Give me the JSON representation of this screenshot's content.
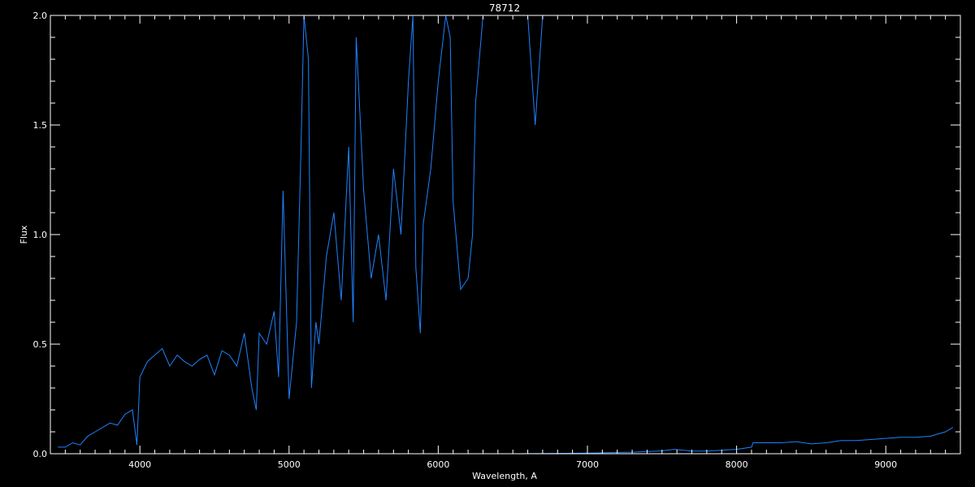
{
  "chart_data": {
    "type": "line",
    "title": "78712",
    "xlabel": "Wavelength, A",
    "ylabel": "Flux",
    "xlim": [
      3400,
      9500
    ],
    "ylim": [
      0,
      2.0
    ],
    "x_ticks": [
      4000,
      5000,
      6000,
      7000,
      8000,
      9000
    ],
    "x_tick_labels": [
      "4000",
      "5000",
      "6000",
      "7000",
      "8000",
      "9000"
    ],
    "y_ticks": [
      0.0,
      0.5,
      1.0,
      1.5,
      2.0
    ],
    "y_tick_labels": [
      "0.0",
      "0.5",
      "1.0",
      "1.5",
      "2.0"
    ],
    "grid": false,
    "background": "#000000",
    "axis_color": "#ffffff",
    "series_color": "#1e82ff",
    "series": [
      {
        "x": [
          3450,
          3500,
          3550,
          3600,
          3650,
          3700,
          3750,
          3800,
          3850,
          3900,
          3950,
          3980,
          4000,
          4050,
          4100,
          4150,
          4200,
          4250,
          4300,
          4350,
          4400,
          4450,
          4500,
          4550,
          4600,
          4650,
          4700,
          4750,
          4780,
          4800,
          4850,
          4900,
          4930,
          4960,
          5000,
          5050,
          5080,
          5100,
          5130,
          5150,
          5180,
          5200,
          5250,
          5300,
          5350,
          5400,
          5430,
          5450,
          5500,
          5550,
          5600,
          5650,
          5700,
          5750,
          5800,
          5830,
          5850,
          5880,
          5900,
          5950,
          6000,
          6050,
          6080,
          6100,
          6150,
          6200,
          6230,
          6250,
          6300,
          6350,
          6400,
          6500,
          6600,
          6650,
          6700,
          6800,
          6900,
          7000,
          7100,
          7200,
          7300,
          7400,
          7500,
          7580,
          7600,
          7700,
          7800,
          7900,
          8000,
          8100,
          8150,
          8200,
          8300,
          8400,
          8500,
          8600,
          8700,
          8800,
          8900,
          9000,
          9100,
          9200,
          9300,
          9400,
          9450
        ],
        "y": [
          0.03,
          0.03,
          0.05,
          0.04,
          0.08,
          0.1,
          0.12,
          0.14,
          0.13,
          0.18,
          0.2,
          0.04,
          0.35,
          0.42,
          0.45,
          0.48,
          0.4,
          0.45,
          0.42,
          0.4,
          0.43,
          0.45,
          0.36,
          0.47,
          0.45,
          0.4,
          0.55,
          0.3,
          0.2,
          0.55,
          0.5,
          0.65,
          0.35,
          1.2,
          0.25,
          0.6,
          1.4,
          2.0,
          1.8,
          0.3,
          0.6,
          0.5,
          0.9,
          1.1,
          0.7,
          1.4,
          0.6,
          1.9,
          1.2,
          0.8,
          1.0,
          0.7,
          1.3,
          1.0,
          1.7,
          2.0,
          0.85,
          0.55,
          1.05,
          1.3,
          1.7,
          2.0,
          1.9,
          1.15,
          0.75,
          0.8,
          1.0,
          1.6,
          2.0,
          2.0,
          2.0,
          2.0,
          2.0,
          1.5,
          2.0,
          2.0,
          2.0,
          2.0,
          2.0,
          2.0,
          2.0,
          2.0,
          2.0,
          2.0,
          2.0,
          2.0,
          2.0,
          2.0,
          2.0,
          2.0,
          2.0,
          2.0,
          2.0,
          2.0,
          2.0,
          2.0,
          2.0,
          2.0,
          2.0,
          2.0,
          2.0,
          2.0,
          2.0,
          2.0,
          2.0
        ]
      },
      {
        "x": [
          4000,
          4500,
          5000,
          5500,
          6000,
          6500,
          7000,
          7300,
          7500,
          7580,
          7700,
          7800,
          7900,
          8000,
          8100,
          8110,
          8200,
          8300,
          8400,
          8500,
          8600,
          8700,
          8800,
          8900,
          9000,
          9100,
          9200,
          9300,
          9400,
          9450
        ],
        "y": [
          0.0,
          0.0,
          0.0,
          0.0,
          0.0,
          0.0,
          0.003,
          0.007,
          0.013,
          0.02,
          0.012,
          0.012,
          0.016,
          0.02,
          0.03,
          0.05,
          0.05,
          0.05,
          0.055,
          0.045,
          0.05,
          0.06,
          0.06,
          0.065,
          0.07,
          0.075,
          0.075,
          0.08,
          0.1,
          0.12
        ]
      }
    ]
  }
}
